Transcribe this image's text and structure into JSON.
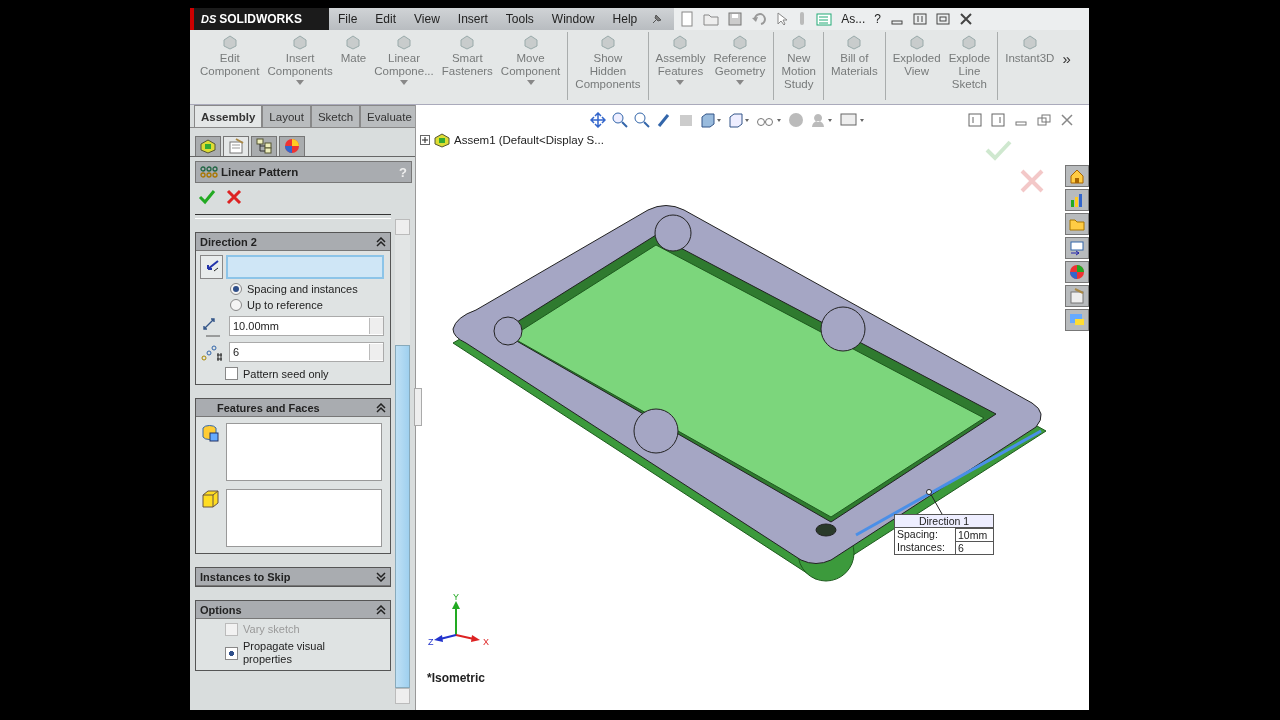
{
  "app": {
    "logo_mark": "DS",
    "logo": "SOLIDWORKS",
    "quick_access_text": "As...",
    "help": "?"
  },
  "menu": [
    "File",
    "Edit",
    "View",
    "Insert",
    "Tools",
    "Window",
    "Help"
  ],
  "ribbon": [
    {
      "lines": [
        "Edit",
        "Component"
      ],
      "dropdown": false,
      "separator_before": false
    },
    {
      "lines": [
        "Insert",
        "Components"
      ],
      "dropdown": true,
      "separator_before": false
    },
    {
      "lines": [
        "Mate"
      ],
      "dropdown": false,
      "separator_before": false
    },
    {
      "lines": [
        "Linear",
        "Compone..."
      ],
      "dropdown": true,
      "separator_before": false
    },
    {
      "lines": [
        "Smart",
        "Fasteners"
      ],
      "dropdown": false,
      "separator_before": false
    },
    {
      "lines": [
        "Move",
        "Component"
      ],
      "dropdown": true,
      "separator_before": false
    },
    {
      "lines": [
        "Show",
        "Hidden",
        "Components"
      ],
      "dropdown": false,
      "separator_before": true
    },
    {
      "lines": [
        "Assembly",
        "Features"
      ],
      "dropdown": true,
      "separator_before": true
    },
    {
      "lines": [
        "Reference",
        "Geometry"
      ],
      "dropdown": true,
      "separator_before": false
    },
    {
      "lines": [
        "New",
        "Motion",
        "Study"
      ],
      "dropdown": false,
      "separator_before": true
    },
    {
      "lines": [
        "Bill of",
        "Materials"
      ],
      "dropdown": false,
      "separator_before": true
    },
    {
      "lines": [
        "Exploded",
        "View"
      ],
      "dropdown": false,
      "separator_before": true
    },
    {
      "lines": [
        "Explode",
        "Line",
        "Sketch"
      ],
      "dropdown": false,
      "separator_before": false
    },
    {
      "lines": [
        "Instant3D"
      ],
      "dropdown": false,
      "separator_before": true
    }
  ],
  "ribbon_more": "»",
  "command_tabs": [
    {
      "label": "Assembly",
      "selected": true
    },
    {
      "label": "Layout",
      "selected": false
    },
    {
      "label": "Sketch",
      "selected": false
    },
    {
      "label": "Evaluate",
      "selected": false
    }
  ],
  "panel_tabs": [
    {
      "selected": false
    },
    {
      "selected": true
    },
    {
      "selected": false
    },
    {
      "selected": false
    }
  ],
  "property_manager": {
    "title": "Linear Pattern",
    "help": "?",
    "sections": [
      {
        "kind": "direction",
        "title": "Direction 2",
        "expanded": true,
        "radios": [
          {
            "label": "Spacing and instances",
            "selected": true
          },
          {
            "label": "Up to reference",
            "selected": false
          }
        ],
        "spacing": "10.00mm",
        "instances": "6",
        "seed_only": {
          "label": "Pattern seed only",
          "checked": false
        }
      },
      {
        "kind": "selection",
        "title": "Features and Faces",
        "expanded": true
      },
      {
        "kind": "skip",
        "title": "Instances to Skip",
        "expanded": false
      },
      {
        "kind": "options",
        "title": "Options",
        "expanded": true,
        "checks": [
          {
            "label": "Vary sketch",
            "checked": false,
            "disabled": true
          },
          {
            "label": "Propagate visual properties",
            "checked": true,
            "disabled": false
          }
        ]
      }
    ]
  },
  "tree": {
    "root": "Assem1  (Default<Display S..."
  },
  "viewport": {
    "view_name": "*Isometric",
    "callout": {
      "title": "Direction 1",
      "rows": [
        {
          "label": "Spacing:",
          "value": "10mm"
        },
        {
          "label": "Instances:",
          "value": "6"
        }
      ]
    },
    "triad": {
      "y": "Y",
      "z": "Z",
      "x": "X"
    }
  }
}
